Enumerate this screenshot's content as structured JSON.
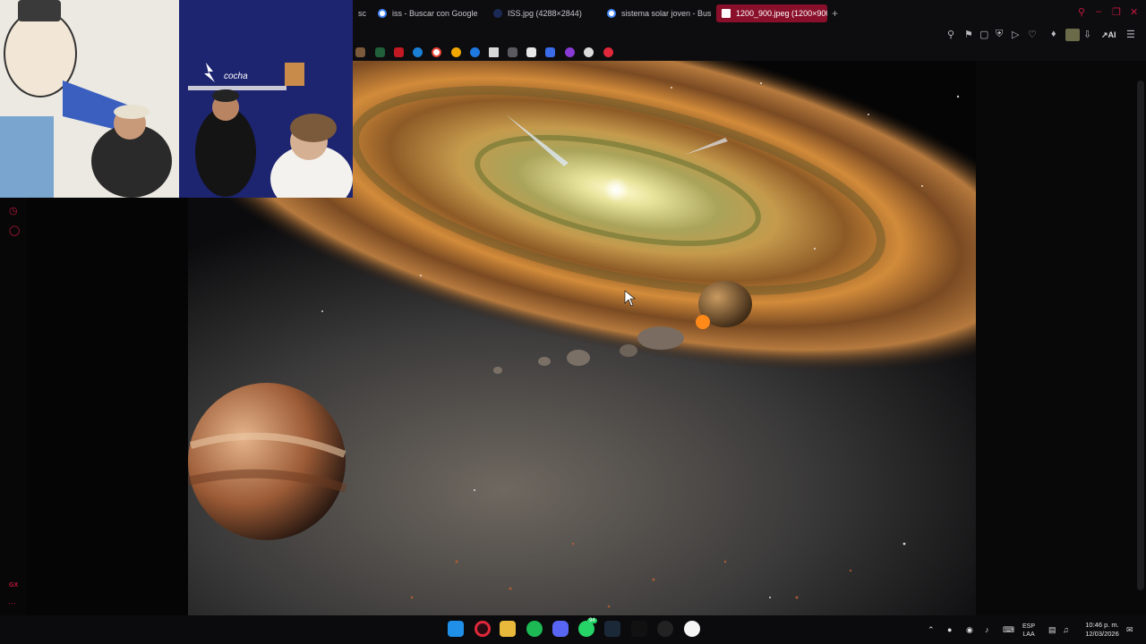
{
  "browser": {
    "tabs": [
      {
        "title": "sc",
        "active": false
      },
      {
        "title": "iss - Buscar con Google",
        "active": false
      },
      {
        "title": "ISS.jpg (4288×2844)",
        "active": false
      },
      {
        "title": "sistema solar joven - Busc",
        "active": false
      },
      {
        "title": "1200_900.jpeg (1200×900",
        "active": true
      }
    ],
    "new_tab": "+",
    "toolbar_ai_label": "AI",
    "accent_color": "#c4183c",
    "sidebar_bottom_label": "GX",
    "sidebar_more": "···"
  },
  "viewer": {
    "image_subject": "young solar system artwork"
  },
  "taskbar": {
    "language": "ESP",
    "layout": "LAA",
    "time": "10:46 p. m.",
    "date": "12/03/2026",
    "whatsapp_badge": "94"
  }
}
